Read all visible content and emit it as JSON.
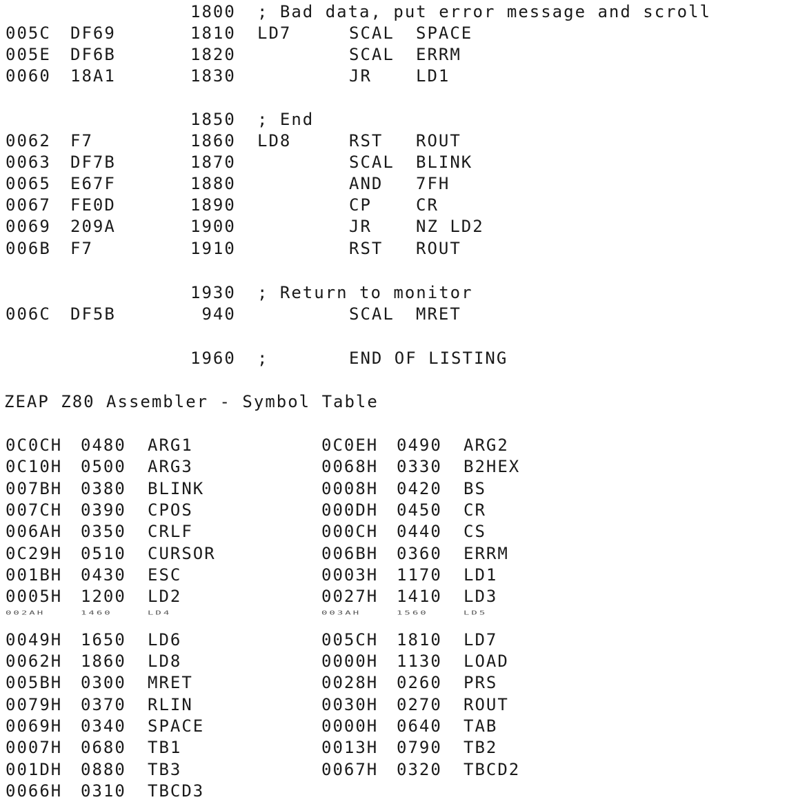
{
  "listing": [
    {
      "num": "1800",
      "comment": "; Bad data, put error message and scroll"
    },
    {
      "addr": "005C",
      "code": "DF69",
      "num": "1810",
      "label": "LD7",
      "op": "SCAL",
      "arg": "SPACE"
    },
    {
      "addr": "005E",
      "code": "DF6B",
      "num": "1820",
      "op": "SCAL",
      "arg": "ERRM"
    },
    {
      "addr": "0060",
      "code": "18A1",
      "num": "1830",
      "op": "JR",
      "arg": "LD1"
    },
    {
      "num": "1850",
      "comment": "; End"
    },
    {
      "addr": "0062",
      "code": "F7",
      "num": "1860",
      "label": "LD8",
      "op": "RST",
      "arg": "ROUT"
    },
    {
      "addr": "0063",
      "code": "DF7B",
      "num": "1870",
      "op": "SCAL",
      "arg": "BLINK"
    },
    {
      "addr": "0065",
      "code": "E67F",
      "num": "1880",
      "op": "AND",
      "arg": "7FH"
    },
    {
      "addr": "0067",
      "code": "FE0D",
      "num": "1890",
      "op": "CP",
      "arg": "CR"
    },
    {
      "addr": "0069",
      "code": "209A",
      "num": "1900",
      "op": "JR",
      "arg": "NZ LD2"
    },
    {
      "addr": "006B",
      "code": "F7",
      "num": "1910",
      "op": "RST",
      "arg": "ROUT"
    },
    {
      "num": "1930",
      "comment": "; Return to monitor"
    },
    {
      "addr": "006C",
      "code": "DF5B",
      "num": " 940",
      "op": "SCAL",
      "arg": "MRET"
    },
    {
      "num": "1960",
      "comment": ";",
      "op": "END OF LISTING"
    }
  ],
  "symbol_table_title": "ZEAP Z80 Assembler - Symbol Table",
  "symbols": [
    {
      "addr": "0C0CH",
      "line": "0480",
      "name": "ARG1"
    },
    {
      "addr": "0C0EH",
      "line": "0490",
      "name": "ARG2"
    },
    {
      "addr": "0C10H",
      "line": "0500",
      "name": "ARG3"
    },
    {
      "addr": "0068H",
      "line": "0330",
      "name": "B2HEX"
    },
    {
      "addr": "007BH",
      "line": "0380",
      "name": "BLINK"
    },
    {
      "addr": "0008H",
      "line": "0420",
      "name": "BS"
    },
    {
      "addr": "007CH",
      "line": "0390",
      "name": "CPOS"
    },
    {
      "addr": "000DH",
      "line": "0450",
      "name": "CR"
    },
    {
      "addr": "006AH",
      "line": "0350",
      "name": "CRLF"
    },
    {
      "addr": "000CH",
      "line": "0440",
      "name": "CS"
    },
    {
      "addr": "0C29H",
      "line": "0510",
      "name": "CURSOR"
    },
    {
      "addr": "006BH",
      "line": "0360",
      "name": "ERRM"
    },
    {
      "addr": "001BH",
      "line": "0430",
      "name": "ESC"
    },
    {
      "addr": "0003H",
      "line": "1170",
      "name": "LD1"
    },
    {
      "addr": "0005H",
      "line": "1200",
      "name": "LD2"
    },
    {
      "addr": "0027H",
      "line": "1410",
      "name": "LD3"
    },
    {
      "addr": "002AH",
      "line": "1460",
      "name": "LD4"
    },
    {
      "addr": "003AH",
      "line": "1560",
      "name": "LD5"
    },
    {
      "addr": "0049H",
      "line": "1650",
      "name": "LD6"
    },
    {
      "addr": "005CH",
      "line": "1810",
      "name": "LD7"
    },
    {
      "addr": "0062H",
      "line": "1860",
      "name": "LD8"
    },
    {
      "addr": "0000H",
      "line": "1130",
      "name": "LOAD"
    },
    {
      "addr": "005BH",
      "line": "0300",
      "name": "MRET"
    },
    {
      "addr": "0028H",
      "line": "0260",
      "name": "PRS"
    },
    {
      "addr": "0079H",
      "line": "0370",
      "name": "RLIN"
    },
    {
      "addr": "0030H",
      "line": "0270",
      "name": "ROUT"
    },
    {
      "addr": "0069H",
      "line": "0340",
      "name": "SPACE"
    },
    {
      "addr": "0000H",
      "line": "0640",
      "name": "TAB"
    },
    {
      "addr": "0007H",
      "line": "0680",
      "name": "TB1"
    },
    {
      "addr": "0013H",
      "line": "0790",
      "name": "TB2"
    },
    {
      "addr": "001DH",
      "line": "0880",
      "name": "TB3"
    },
    {
      "addr": "0067H",
      "line": "0320",
      "name": "TBCD2"
    },
    {
      "addr": "0066H",
      "line": "0310",
      "name": "TBCD3"
    }
  ]
}
